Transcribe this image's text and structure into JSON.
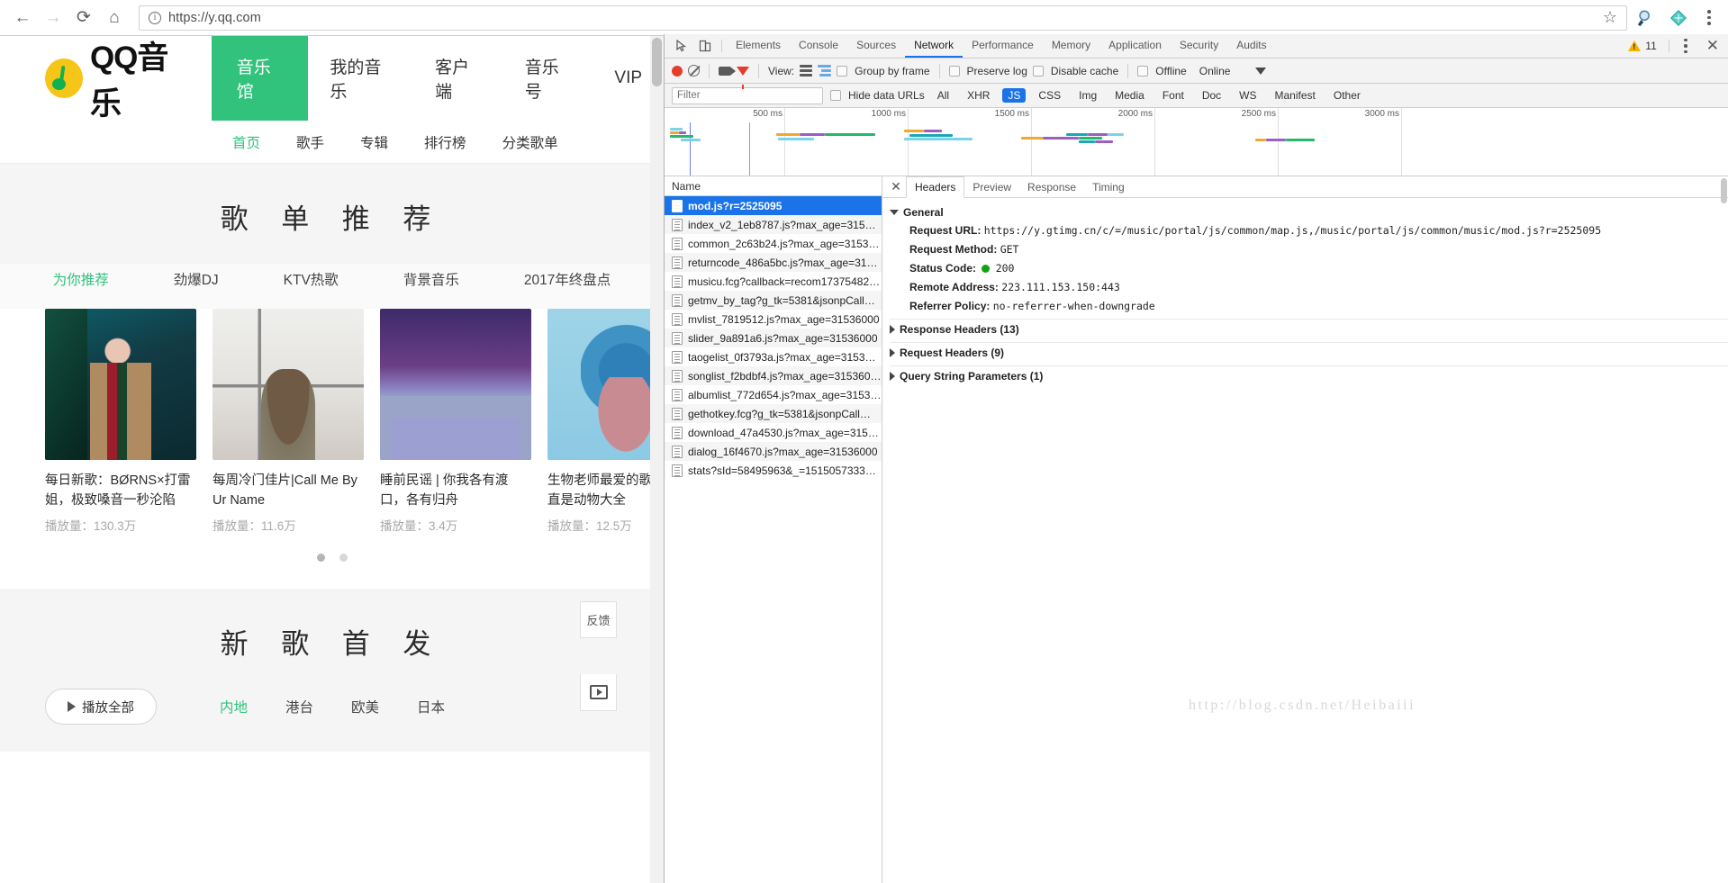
{
  "browser": {
    "back_icon": "back-arrow-icon",
    "forward_icon": "forward-arrow-icon",
    "reload_icon": "reload-icon",
    "home_icon": "home-icon",
    "url": "https://y.qq.com",
    "info_glyph": "i",
    "bookmark_icon": "star-icon",
    "extension_icons": [
      "magnifier-extension-icon",
      "diamond-extension-icon"
    ],
    "menu_icon": "kebab-menu-icon"
  },
  "qq": {
    "logo_text": "QQ音乐",
    "nav": [
      {
        "label": "音乐馆",
        "active": true
      },
      {
        "label": "我的音乐",
        "active": false
      },
      {
        "label": "客户端",
        "active": false
      },
      {
        "label": "音乐号",
        "active": false
      },
      {
        "label": "VIP",
        "active": false
      }
    ],
    "subnav": [
      {
        "label": "首页",
        "active": true
      },
      {
        "label": "歌手",
        "active": false
      },
      {
        "label": "专辑",
        "active": false
      },
      {
        "label": "排行榜",
        "active": false
      },
      {
        "label": "分类歌单",
        "active": false
      }
    ],
    "section1": {
      "title": "歌 单 推 荐",
      "tabs": [
        {
          "label": "为你推荐",
          "active": true
        },
        {
          "label": "劲爆DJ",
          "active": false
        },
        {
          "label": "KTV热歌",
          "active": false
        },
        {
          "label": "背景音乐",
          "active": false
        },
        {
          "label": "2017年终盘点",
          "active": false
        }
      ],
      "cards": [
        {
          "title": "每日新歌：BØRNS×打雷姐，极致嗓音一秒沦陷",
          "meta": "播放量：130.3万"
        },
        {
          "title": "每周冷门佳片|Call Me By Ur Name",
          "meta": "播放量：11.6万"
        },
        {
          "title": "睡前民谣 | 你我各有渡口，各有归舟",
          "meta": "播放量：3.4万"
        },
        {
          "title": "生物老师最爱的歌单，简直是动物大全",
          "meta": "播放量：12.5万"
        }
      ],
      "dots": 2
    },
    "section2": {
      "title": "新 歌 首 发",
      "play_all": "播放全部",
      "genres": [
        {
          "label": "内地",
          "active": true
        },
        {
          "label": "港台",
          "active": false
        },
        {
          "label": "欧美",
          "active": false
        },
        {
          "label": "日本",
          "active": false
        }
      ],
      "feedback_label": "反馈"
    }
  },
  "devtools": {
    "inspect_icon": "inspect-element-icon",
    "device_icon": "device-toolbar-icon",
    "tabs": [
      {
        "label": "Elements",
        "active": false
      },
      {
        "label": "Console",
        "active": false
      },
      {
        "label": "Sources",
        "active": false
      },
      {
        "label": "Network",
        "active": true
      },
      {
        "label": "Performance",
        "active": false
      },
      {
        "label": "Memory",
        "active": false
      },
      {
        "label": "Application",
        "active": false
      },
      {
        "label": "Security",
        "active": false
      },
      {
        "label": "Audits",
        "active": false
      }
    ],
    "warning_count": "11",
    "more_icon": "kebab-menu-icon",
    "close_icon": "close-icon",
    "toolbar": {
      "record_icon": "record-button-icon",
      "clear_icon": "clear-icon",
      "capture_screenshots_icon": "camera-icon",
      "filter_icon": "filter-funnel-icon",
      "view_label": "View:",
      "view_list_icon": "list-view-icon",
      "view_waterfall_icon": "waterfall-view-icon",
      "group_by_frame": "Group by frame",
      "preserve_log": "Preserve log",
      "disable_cache": "Disable cache",
      "offline": "Offline",
      "throttling": "Online",
      "throttling_caret": "chevron-down-icon"
    },
    "filterbar": {
      "filter_placeholder": "Filter",
      "hide_data_urls": "Hide data URLs",
      "types": [
        {
          "label": "All",
          "active": false
        },
        {
          "label": "XHR",
          "active": false
        },
        {
          "label": "JS",
          "active": true
        },
        {
          "label": "CSS",
          "active": false
        },
        {
          "label": "Img",
          "active": false
        },
        {
          "label": "Media",
          "active": false
        },
        {
          "label": "Font",
          "active": false
        },
        {
          "label": "Doc",
          "active": false
        },
        {
          "label": "WS",
          "active": false
        },
        {
          "label": "Manifest",
          "active": false
        },
        {
          "label": "Other",
          "active": false
        }
      ]
    },
    "overview_ticks": [
      "500 ms",
      "1000 ms",
      "1500 ms",
      "2000 ms",
      "2500 ms",
      "3000 ms"
    ],
    "name_column_header": "Name",
    "requests": [
      {
        "name": "mod.js?r=2525095",
        "selected": true
      },
      {
        "name": "index_v2_1eb8787.js?max_age=3153…",
        "selected": false
      },
      {
        "name": "common_2c63b24.js?max_age=3153…",
        "selected": false
      },
      {
        "name": "returncode_486a5bc.js?max_age=315…",
        "selected": false
      },
      {
        "name": "musicu.fcg?callback=recom17375482…",
        "selected": false
      },
      {
        "name": "getmv_by_tag?g_tk=5381&jsonpCall…",
        "selected": false
      },
      {
        "name": "mvlist_7819512.js?max_age=31536000",
        "selected": false
      },
      {
        "name": "slider_9a891a6.js?max_age=31536000",
        "selected": false
      },
      {
        "name": "taogelist_0f3793a.js?max_age=31536…",
        "selected": false
      },
      {
        "name": "songlist_f2bdbf4.js?max_age=315360…",
        "selected": false
      },
      {
        "name": "albumlist_772d654.js?max_age=3153…",
        "selected": false
      },
      {
        "name": "gethotkey.fcg?g_tk=5381&jsonpCall…",
        "selected": false
      },
      {
        "name": "download_47a4530.js?max_age=315…",
        "selected": false
      },
      {
        "name": "dialog_16f4670.js?max_age=31536000",
        "selected": false
      },
      {
        "name": "stats?sId=58495963&_=1515057333…",
        "selected": false
      }
    ],
    "detail": {
      "close_icon": "close-icon",
      "tabs": [
        {
          "label": "Headers",
          "active": true
        },
        {
          "label": "Preview",
          "active": false
        },
        {
          "label": "Response",
          "active": false
        },
        {
          "label": "Timing",
          "active": false
        }
      ],
      "general_label": "General",
      "request_url_label": "Request URL:",
      "request_url_value": "https://y.gtimg.cn/c/=/music/portal/js/common/map.js,/music/portal/js/common/music/mod.js?r=2525095",
      "request_method_label": "Request Method:",
      "request_method_value": "GET",
      "status_code_label": "Status Code:",
      "status_code_value": "200",
      "remote_address_label": "Remote Address:",
      "remote_address_value": "223.111.153.150:443",
      "referrer_policy_label": "Referrer Policy:",
      "referrer_policy_value": "no-referrer-when-downgrade",
      "response_headers": "Response Headers (13)",
      "request_headers": "Request Headers (9)",
      "query_string_parameters": "Query String Parameters (1)"
    }
  },
  "watermark": "http://blog.csdn.net/Heibaiii",
  "colors": {
    "accent_green": "#31c27c",
    "devtools_blue": "#1a73e8",
    "status_green": "#10a310",
    "record_red": "#e33e2b"
  }
}
